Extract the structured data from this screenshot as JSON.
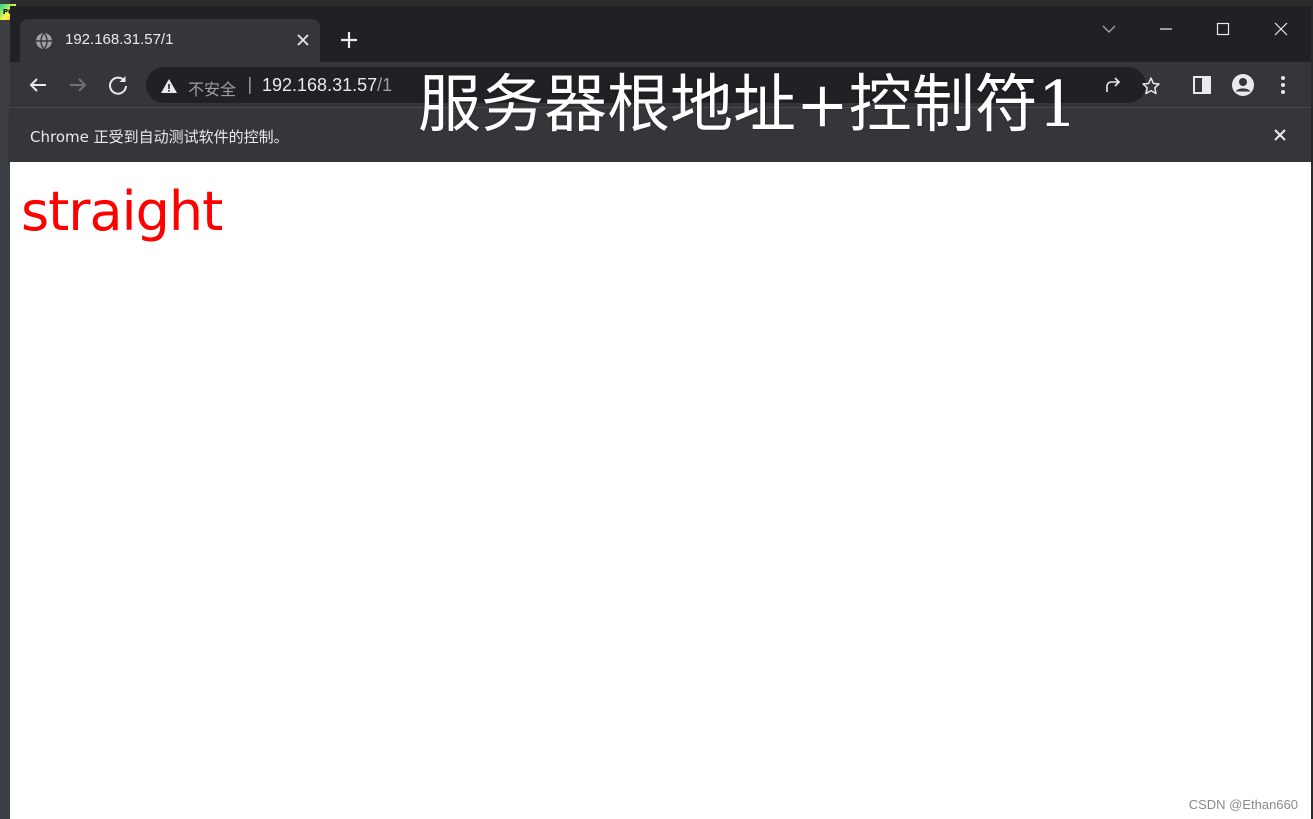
{
  "browser": {
    "tab": {
      "title": "192.168.31.57/1",
      "close_icon": "close-icon",
      "favicon": "globe-icon"
    },
    "new_tab_icon": "plus-icon",
    "window_controls": [
      "chevron-down-icon",
      "minimize-icon",
      "maximize-icon",
      "close-icon"
    ],
    "toolbar": {
      "back_icon": "arrow-left-icon",
      "forward_icon": "arrow-right-icon",
      "reload_icon": "reload-icon",
      "address": {
        "security_label": "不安全",
        "separator": "|",
        "host": "192.168.31.57",
        "path": "/1"
      },
      "right_icons": [
        "share-icon",
        "star-icon",
        "side-panel-icon",
        "profile-icon",
        "menu-icon"
      ]
    },
    "infobar": {
      "message": "Chrome 正受到自动测试软件的控制。"
    }
  },
  "overlay": {
    "caption": "服务器根地址+控制符1"
  },
  "page": {
    "text": "straight",
    "text_color": "#ff0000"
  },
  "watermark": "CSDN @Ethan660",
  "colors": {
    "frame": "#202124",
    "toolbar": "#35363a",
    "text_light": "#e8eaed",
    "text_dim": "#9aa0a6"
  }
}
